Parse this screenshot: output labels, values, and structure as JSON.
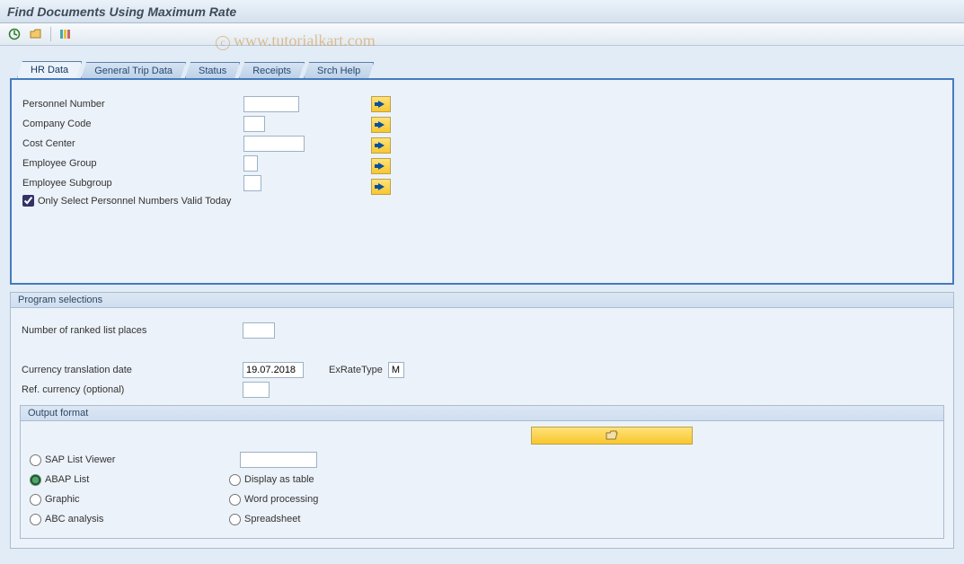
{
  "title": "Find Documents Using Maximum Rate",
  "watermark": "www.tutorialkart.com",
  "tabs": {
    "hr_data": "HR Data",
    "general_trip_data": "General Trip Data",
    "status": "Status",
    "receipts": "Receipts",
    "srch_help": "Srch Help"
  },
  "hr_form": {
    "personnel_number_label": "Personnel Number",
    "personnel_number_value": "",
    "company_code_label": "Company Code",
    "company_code_value": "",
    "cost_center_label": "Cost Center",
    "cost_center_value": "",
    "employee_group_label": "Employee Group",
    "employee_group_value": "",
    "employee_subgroup_label": "Employee Subgroup",
    "employee_subgroup_value": "",
    "only_valid_today_label": "Only Select Personnel Numbers Valid Today"
  },
  "program_selections": {
    "header": "Program selections",
    "ranked_places_label": "Number of ranked list places",
    "ranked_places_value": "",
    "currency_date_label": "Currency translation date",
    "currency_date_value": "19.07.2018",
    "ex_rate_type_label": "ExRateType",
    "ex_rate_type_value": "M",
    "ref_currency_label": "Ref. currency (optional)",
    "ref_currency_value": ""
  },
  "output_format": {
    "header": "Output format",
    "sap_list_viewer": "SAP List Viewer",
    "sap_list_viewer_value": "",
    "abap_list": "ABAP List",
    "graphic": "Graphic",
    "abc_analysis": "ABC analysis",
    "display_as_table": "Display as table",
    "word_processing": "Word processing",
    "spreadsheet": "Spreadsheet"
  }
}
